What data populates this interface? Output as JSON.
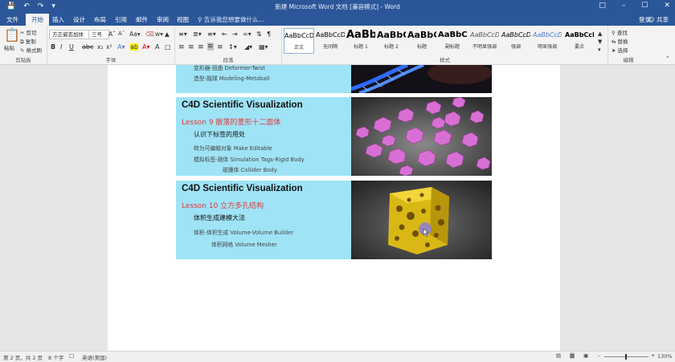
{
  "titlebar": {
    "title": "新建 Microsoft Word 文档 [兼容模式] - Word"
  },
  "tabs": [
    "文件",
    "开始",
    "插入",
    "设计",
    "布局",
    "引用",
    "邮件",
    "审阅",
    "视图"
  ],
  "tell_me": "告诉我您想要做什么...",
  "account": {
    "signin": "登录",
    "share": "共享"
  },
  "ribbon": {
    "clipboard": {
      "paste": "粘贴",
      "cut": "剪切",
      "copy": "复制",
      "format_painter": "格式刷",
      "label": "剪贴板"
    },
    "font": {
      "name": "方正姿态加体",
      "size": "三号",
      "label": "字体"
    },
    "paragraph": {
      "label": "段落"
    },
    "styles": {
      "label": "样式",
      "items": [
        {
          "sample": "AaBbCcDd",
          "name": "正文"
        },
        {
          "sample": "AaBbCcDd",
          "name": "无间隔"
        },
        {
          "sample": "AaBb",
          "name": "标题 1"
        },
        {
          "sample": "AaBbC",
          "name": "标题 2"
        },
        {
          "sample": "AaBbC",
          "name": "标题"
        },
        {
          "sample": "AaBbC",
          "name": "副标题"
        },
        {
          "sample": "AaBbCcDd",
          "name": "不明显强调"
        },
        {
          "sample": "AaBbCcDd",
          "name": "强调"
        },
        {
          "sample": "AaBbCcDd",
          "name": "明显强调"
        },
        {
          "sample": "AaBbCcDc",
          "name": "要点"
        }
      ]
    },
    "editing": {
      "find": "查找",
      "replace": "替换",
      "select": "选择",
      "label": "编辑"
    }
  },
  "document": {
    "top_partial": {
      "line1": "变形器-扭曲 Deformer-Twist",
      "line2": "造型-融球 Modeling-Metaball"
    },
    "cards": [
      {
        "title": "C4D Scientific Visualization",
        "lesson": "Lesson 9 散落的菱形十二面体",
        "hint": "认识下标签的用处",
        "lines": [
          "转为可编辑对象 Make Editable",
          "模拟标签-刚体 Simulation Tags-Rigid Body",
          "碰撞体 Collider Body"
        ]
      },
      {
        "title": "C4D Scientific Visualization",
        "lesson": "Lesson 10 立方多孔结构",
        "hint": "体积生成建模大法",
        "lines": [
          "体积-体积生成 Volume-Volume Builder",
          "体积网格 Volume Mesher"
        ]
      }
    ]
  },
  "status": {
    "page": "第 2 页，共 2 页",
    "words": "8 个字",
    "language": "英语(美国)",
    "zoom": "130%"
  }
}
